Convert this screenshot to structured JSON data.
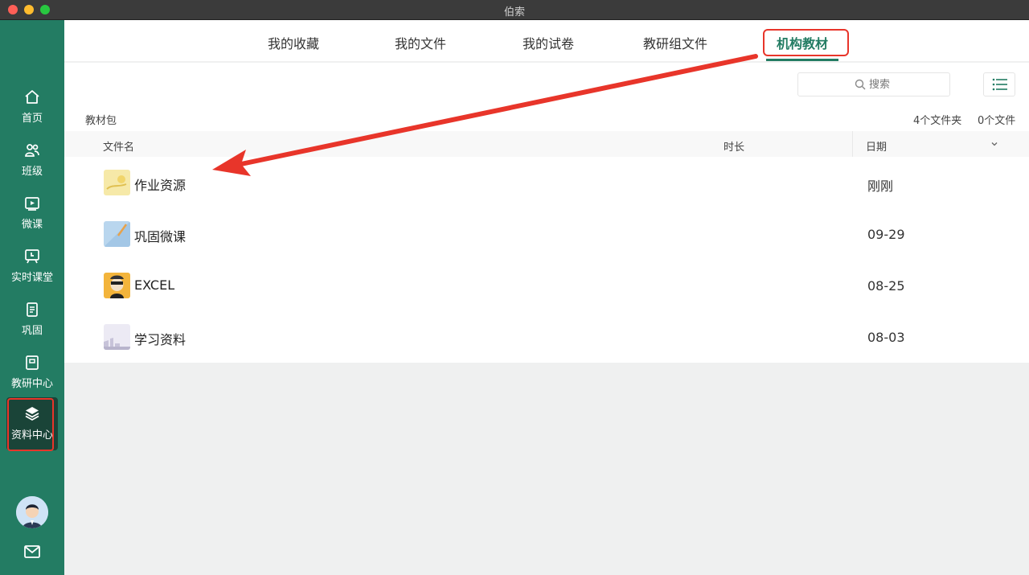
{
  "window": {
    "title": "伯索"
  },
  "sidebar": {
    "items": [
      {
        "label": "首页",
        "icon": "home-icon"
      },
      {
        "label": "班级",
        "icon": "users-icon"
      },
      {
        "label": "微课",
        "icon": "video-icon"
      },
      {
        "label": "实时课堂",
        "icon": "classroom-icon"
      },
      {
        "label": "巩固",
        "icon": "notebook-icon"
      },
      {
        "label": "教研中心",
        "icon": "book-icon"
      },
      {
        "label": "资料中心",
        "icon": "layers-icon",
        "active": true
      }
    ],
    "avatar": "avatar",
    "mail_icon": "mail-icon"
  },
  "tabs": [
    {
      "label": "我的收藏"
    },
    {
      "label": "我的文件"
    },
    {
      "label": "我的试卷"
    },
    {
      "label": "教研组文件"
    },
    {
      "label": "机构教材",
      "active": true
    }
  ],
  "search": {
    "placeholder": "搜索"
  },
  "breadcrumb": "教材包",
  "counts": {
    "folders": "4个文件夹",
    "files": "0个文件"
  },
  "table": {
    "columns": {
      "name": "文件名",
      "duration": "时长",
      "date": "日期"
    },
    "rows": [
      {
        "name": "作业资源",
        "date": "刚刚"
      },
      {
        "name": "巩固微课",
        "date": "09-29"
      },
      {
        "name": "EXCEL",
        "date": "08-25"
      },
      {
        "name": "学习资料",
        "date": "08-03"
      }
    ]
  },
  "colors": {
    "brand": "#237c63",
    "sidebar_active": "#1a4438",
    "annotation": "#e8352a",
    "titlebar": "#3b3b3b"
  }
}
